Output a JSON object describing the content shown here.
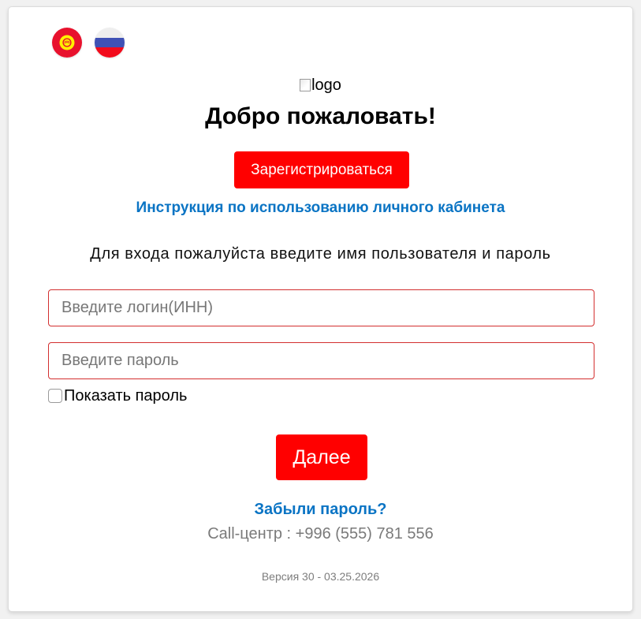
{
  "languages": [
    {
      "code": "ky",
      "icon": "kyrgyzstan-flag-icon"
    },
    {
      "code": "ru",
      "icon": "russia-flag-icon"
    }
  ],
  "logo_alt": "logo",
  "welcome_title": "Добро пожаловать!",
  "register_label": "Зарегистрироваться",
  "instruction_link": "Инструкция по использованию личного кабинета",
  "prompt_text": "Для входа пожалуйста введите имя пользователя и пароль",
  "login": {
    "placeholder": "Введите логин(ИНН)",
    "value": ""
  },
  "password": {
    "placeholder": "Введите пароль",
    "value": ""
  },
  "show_password": {
    "label": "Показать пароль",
    "checked": false
  },
  "next_label": "Далее",
  "forgot_link": "Забыли пароль?",
  "call_center": "Call-центр : +996 (555) 781 556",
  "version": "Версия 30 - 03.25.2026",
  "colors": {
    "accent_red": "#ff0000",
    "link_blue": "#0a74c4",
    "field_border": "#d32f2f",
    "muted_text": "#7a7a7a"
  }
}
